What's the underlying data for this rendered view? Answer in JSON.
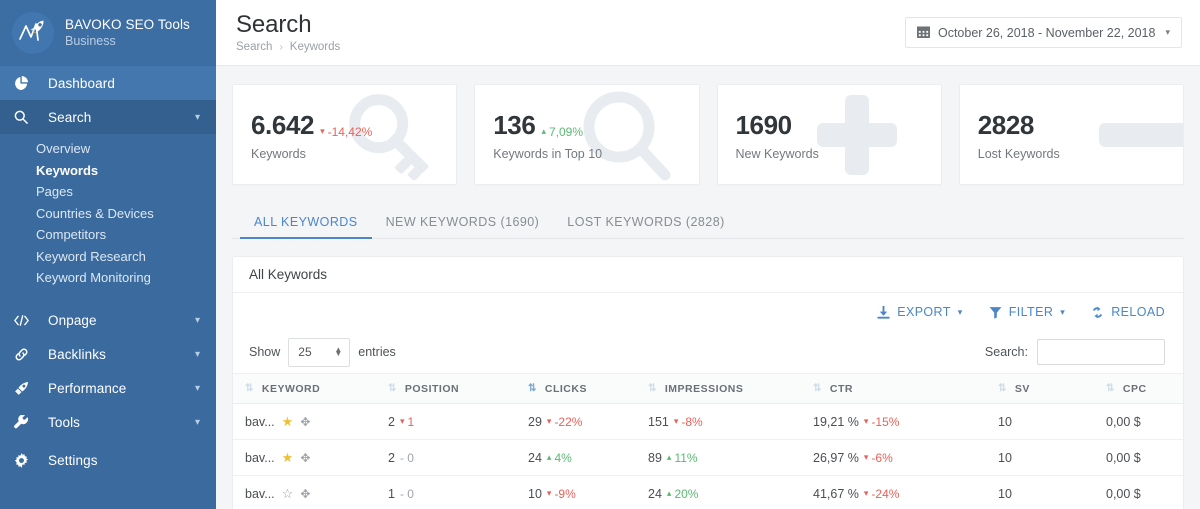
{
  "brand": {
    "title": "BAVOKO SEO Tools",
    "subtitle": "Business",
    "logo_icon": "rocket-chart-logo"
  },
  "sidebar": {
    "items": [
      {
        "label": "Dashboard",
        "icon": "pie-chart-icon",
        "expandable": false,
        "state": "active"
      },
      {
        "label": "Search",
        "icon": "search-icon",
        "expandable": true,
        "state": "open"
      },
      {
        "label": "Onpage",
        "icon": "code-icon",
        "expandable": true,
        "state": "normal"
      },
      {
        "label": "Backlinks",
        "icon": "link-icon",
        "expandable": true,
        "state": "normal"
      },
      {
        "label": "Performance",
        "icon": "rocket-icon",
        "expandable": true,
        "state": "normal"
      },
      {
        "label": "Tools",
        "icon": "wrench-icon",
        "expandable": true,
        "state": "normal"
      },
      {
        "label": "Settings",
        "icon": "gear-icon",
        "expandable": false,
        "state": "normal"
      }
    ],
    "search_subitems": [
      {
        "label": "Overview",
        "current": false
      },
      {
        "label": "Keywords",
        "current": true
      },
      {
        "label": "Pages",
        "current": false
      },
      {
        "label": "Countries & Devices",
        "current": false
      },
      {
        "label": "Competitors",
        "current": false
      },
      {
        "label": "Keyword Research",
        "current": false
      },
      {
        "label": "Keyword Monitoring",
        "current": false
      }
    ]
  },
  "header": {
    "title": "Search",
    "breadcrumb": [
      "Search",
      "Keywords"
    ],
    "breadcrumb_sep": "›",
    "daterange": {
      "icon": "calendar-icon",
      "value": "October 26, 2018 - November 22, 2018",
      "caret": "▾"
    }
  },
  "cards": [
    {
      "value": "6.642",
      "label": "Keywords",
      "delta": "-14,42%",
      "dir": "down",
      "icon": "key-icon"
    },
    {
      "value": "136",
      "label": "Keywords in Top 10",
      "delta": "7,09%",
      "dir": "up",
      "icon": "magnifier-icon"
    },
    {
      "value": "1690",
      "label": "New Keywords",
      "delta": "",
      "dir": "none",
      "icon": "plus-icon"
    },
    {
      "value": "2828",
      "label": "Lost Keywords",
      "delta": "",
      "dir": "none",
      "icon": "minus-icon"
    }
  ],
  "tabs": [
    {
      "label": "ALL KEYWORDS",
      "selected": true
    },
    {
      "label": "NEW KEYWORDS (1690)",
      "selected": false
    },
    {
      "label": "LOST KEYWORDS (2828)",
      "selected": false
    }
  ],
  "panel": {
    "title": "All Keywords",
    "tools": [
      {
        "label": "EXPORT",
        "icon": "download-icon",
        "caret": true
      },
      {
        "label": "FILTER",
        "icon": "funnel-icon",
        "caret": true
      },
      {
        "label": "RELOAD",
        "icon": "refresh-icon",
        "caret": false
      }
    ],
    "show_label": "Show",
    "show_value": "25",
    "entries_label": "entries",
    "search_label": "Search:",
    "search_value": "",
    "search_placeholder": ""
  },
  "table": {
    "columns": [
      {
        "key": "keyword",
        "label": "KEYWORD",
        "sorted": false
      },
      {
        "key": "position",
        "label": "POSITION",
        "sorted": false
      },
      {
        "key": "clicks",
        "label": "CLICKS",
        "sorted": true
      },
      {
        "key": "impressions",
        "label": "IMPRESSIONS",
        "sorted": false
      },
      {
        "key": "ctr",
        "label": "CTR",
        "sorted": false
      },
      {
        "key": "sv",
        "label": "SV",
        "sorted": false
      },
      {
        "key": "cpc",
        "label": "CPC",
        "sorted": false
      }
    ],
    "rows": [
      {
        "keyword": "bav...",
        "starred": true,
        "position": "2",
        "position_delta": "1",
        "position_dir": "down",
        "clicks": "29",
        "clicks_delta": "-22%",
        "clicks_dir": "down",
        "impressions": "151",
        "impressions_delta": "-8%",
        "impressions_dir": "down",
        "ctr": "19,21 %",
        "ctr_delta": "-15%",
        "ctr_dir": "down",
        "sv": "10",
        "cpc": "0,00 $"
      },
      {
        "keyword": "bav...",
        "starred": true,
        "position": "2",
        "position_delta": "0",
        "position_dir": "flat",
        "clicks": "24",
        "clicks_delta": "4%",
        "clicks_dir": "up",
        "impressions": "89",
        "impressions_delta": "11%",
        "impressions_dir": "up",
        "ctr": "26,97 %",
        "ctr_delta": "-6%",
        "ctr_dir": "down",
        "sv": "10",
        "cpc": "0,00 $"
      },
      {
        "keyword": "bav...",
        "starred": false,
        "position": "1",
        "position_delta": "0",
        "position_dir": "flat",
        "clicks": "10",
        "clicks_delta": "-9%",
        "clicks_dir": "down",
        "impressions": "24",
        "impressions_delta": "20%",
        "impressions_dir": "up",
        "ctr": "41,67 %",
        "ctr_delta": "-24%",
        "ctr_dir": "down",
        "sv": "10",
        "cpc": "0,00 $"
      }
    ]
  },
  "colors": {
    "sidebar": "#3a6a9e",
    "sidebar_active": "#4477ae",
    "accent": "#4a86c8",
    "positive": "#5bb974",
    "negative": "#e8615a",
    "star": "#f0c02c",
    "card_art": "#e8ecf1"
  }
}
